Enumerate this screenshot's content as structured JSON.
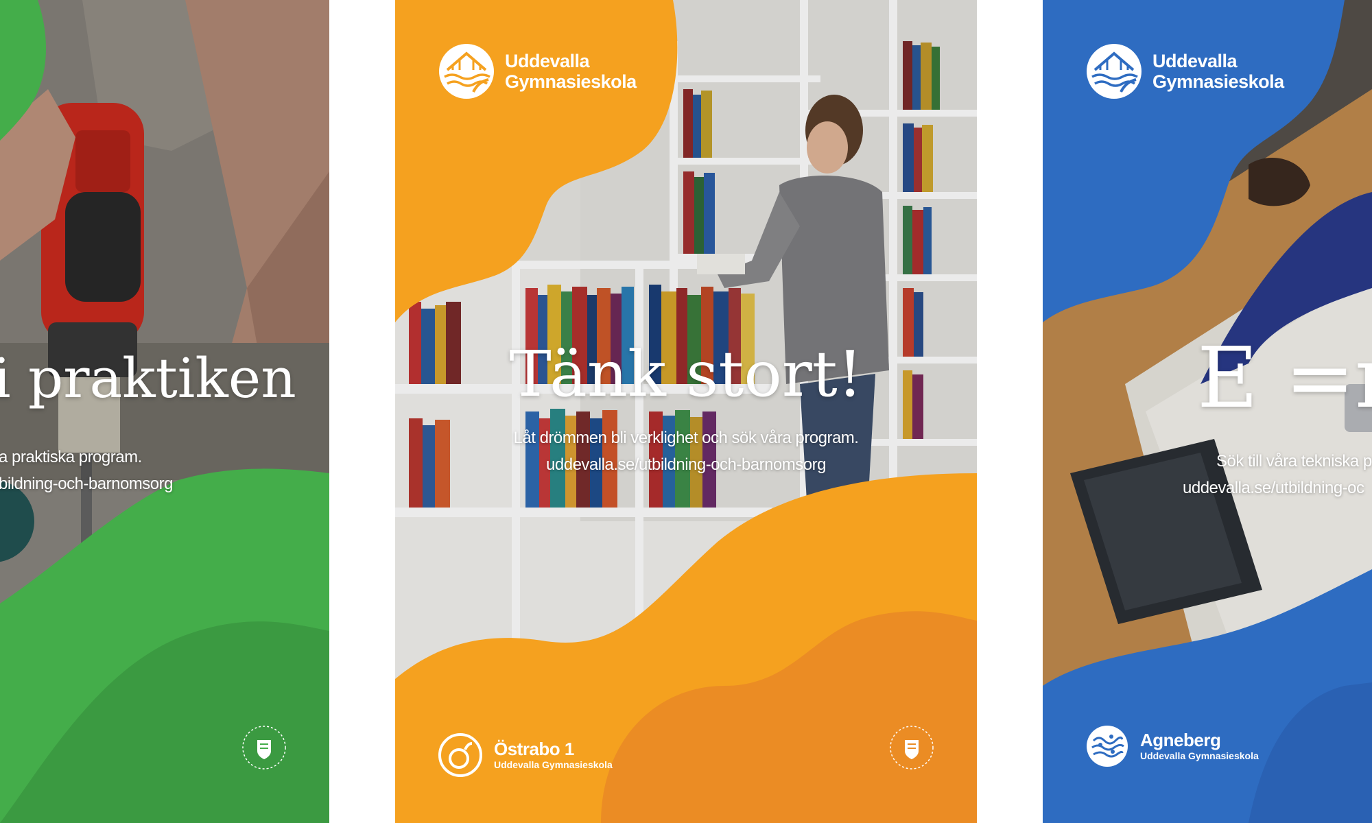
{
  "colors": {
    "green": "#44ad4a",
    "green_dark": "#3b9a41",
    "orange": "#f5a11f",
    "orange_dark": "#eb8c24",
    "blue": "#2e6cc1",
    "blue_dark": "#2a61b3"
  },
  "posters": [
    {
      "headline": "i praktiken",
      "line1": "a praktiska program.",
      "line2": "bildning-och-barnomsorg",
      "kommun_icon": "uddevalla-kommun-seal-icon"
    },
    {
      "logo": {
        "line1": "Uddevalla",
        "line2": "Gymnasieskola",
        "icon": "uddevalla-gymnasieskola-logo-icon"
      },
      "headline": "Tänk stort!",
      "line1": "Låt drömmen bli verklighet och sök våra program.",
      "line2": "uddevalla.se/utbildning-och-barnomsorg",
      "badge": {
        "title": "Östrabo 1",
        "subtitle": "Uddevalla Gymnasieskola",
        "icon": "ostrabo-logo-icon"
      },
      "kommun_icon": "uddevalla-kommun-seal-icon"
    },
    {
      "logo": {
        "line1": "Uddevalla",
        "line2": "Gymnasieskola",
        "icon": "uddevalla-gymnasieskola-logo-icon"
      },
      "headline": "E =n",
      "line1": "Sök till våra tekniska p",
      "line2": "uddevalla.se/utbildning-oc",
      "badge": {
        "title": "Agneberg",
        "subtitle": "Uddevalla Gymnasieskola",
        "icon": "agneberg-logo-icon"
      }
    }
  ]
}
